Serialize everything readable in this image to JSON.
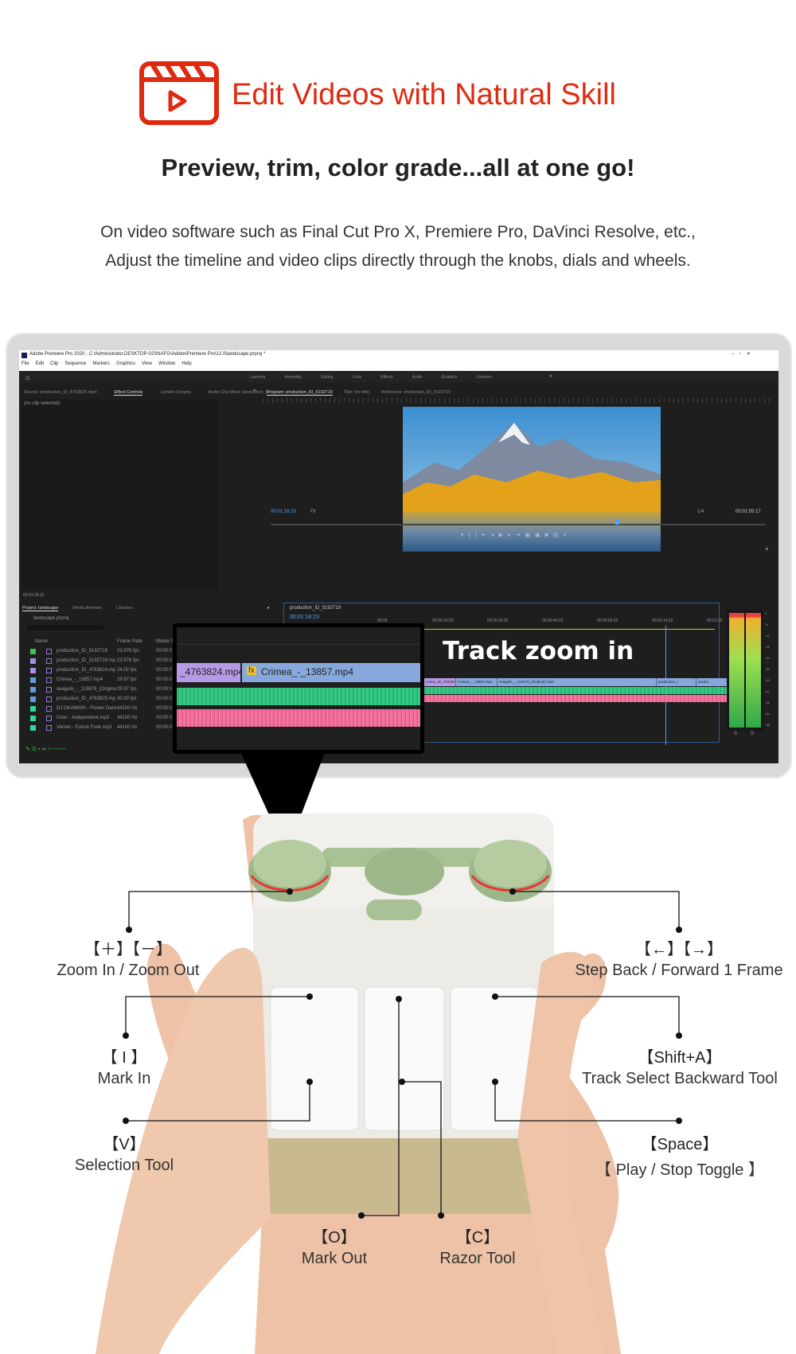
{
  "header": {
    "logo_icon": "video-clapper-play-icon",
    "title": "Edit Videos with Natural Skill",
    "subtitle": "Preview, trim, color grade...all at one go!",
    "body_lines": [
      "On video software such as Final Cut Pro X, Premiere Pro, DaVinci Resolve, etc.,",
      "Adjust the timeline and video clips directly through the knobs, dials and wheels."
    ],
    "accent_color": "#e02a10"
  },
  "app": {
    "window_title": "Adobe Premiere Pro 2020 - C:\\Administrator.DESKTOP-02SNAFG\\Adobe\\Premiere Pro\\12.0\\landscape.prproj *",
    "menu": [
      "File",
      "Edit",
      "Clip",
      "Sequence",
      "Markers",
      "Graphics",
      "View",
      "Window",
      "Help"
    ],
    "workspaces": [
      "Learning",
      "Assembly",
      "Editing",
      "Color",
      "Effects",
      "Audio",
      "Graphics",
      "Libraries"
    ],
    "source_tabs": [
      "Source: production_ID_4763825.mp4",
      "Effect Controls",
      "Lumetri Scopes",
      "Audio Clip Mixer: production_ID"
    ],
    "no_clip": "(no clip selected)",
    "source_timecode": "00:01:18:23",
    "program_tabs": [
      "Program: production_ID_5192719",
      "Title: (no title)",
      "Reference: production_ID_5192719"
    ],
    "program_timecode": "00:01:18:23",
    "fit": "Fit",
    "resolution": "1/4",
    "duration": "00:01:55:17",
    "project_tabs": [
      "Project: landscape",
      "Media Browser",
      "Libraries"
    ],
    "project_file": "landscape.prproj",
    "columns": [
      "Name",
      "Frame Rate",
      "Media S"
    ],
    "items": [
      {
        "name": "production_ID_5192719",
        "rate": "23.976 fps",
        "start": "00:00:0",
        "color": "#3fbf5a"
      },
      {
        "name": "production_ID_5192719.mp",
        "rate": "23.976 fps",
        "start": "00:00:0",
        "color": "#a98be8"
      },
      {
        "name": "production_ID_4763824.mp",
        "rate": "24.00 fps",
        "start": "00:00:0",
        "color": "#a98be8"
      },
      {
        "name": "Crimea_-_13857.mp4",
        "rate": "29.97 fps",
        "start": "00:00:0",
        "color": "#5e9de0"
      },
      {
        "name": "seagulls_-_113679_(Origina",
        "rate": "29.97 fps",
        "start": "00:00:0",
        "color": "#5e9de0"
      },
      {
        "name": "production_ID_4763825.mp",
        "rate": "30.00 fps",
        "start": "00:00:0",
        "color": "#5e9de0"
      },
      {
        "name": "DJ OKAWARI - Flower Danc",
        "rate": "44100 Hz",
        "start": "00:00:0",
        "color": "#2fd79a"
      },
      {
        "name": "Uzier - Independent.mp3",
        "rate": "44100 Hz",
        "start": "00:00:0",
        "color": "#2fd79a"
      },
      {
        "name": "Vanien - Future Funk.mp3",
        "rate": "44100 Hz",
        "start": "00:00:0",
        "color": "#2fd79a"
      }
    ],
    "sequence_tab": "production_ID_5192719",
    "sequence_timecode": "00:01:18:23",
    "ruler": [
      "00:00",
      "00:00:14:23",
      "00:00:29:23",
      "00:00:44:22",
      "00:00:59:22",
      "00:01:14:22",
      "00:01:29"
    ],
    "clips": [
      "uction_ID_4763824",
      "Crimea_-_13857.mp4",
      "seagulls_-_113679_(Original).mp4",
      "production_I",
      "produc"
    ],
    "meter_scale": [
      "0",
      "-6",
      "-12",
      "-18",
      "-24",
      "-30",
      "-36",
      "-42",
      "-48",
      "-54",
      "-dB"
    ],
    "meter_solo": [
      "S",
      "S"
    ]
  },
  "callout": {
    "clip_a": "_4763824.mp4",
    "clip_b": "Crimea_-_13857.mp4",
    "fx": "fx",
    "caption": "Track zoom in"
  },
  "keys": [
    {
      "key": "【＋】【－】",
      "action": "Zoom In / Zoom Out"
    },
    {
      "key": "【←】【→】",
      "action": "Step Back / Forward 1 Frame"
    },
    {
      "key": "【 I 】",
      "action": "Mark In"
    },
    {
      "key": "【Shift+A】",
      "action": "Track Select Backward Tool"
    },
    {
      "key": "【V】",
      "action": "Selection Tool"
    },
    {
      "key": "【Space】",
      "action": "【 Play / Stop Toggle 】"
    },
    {
      "key": "【O】",
      "action": "Mark Out"
    },
    {
      "key": "【C】",
      "action": "Razor Tool"
    }
  ],
  "device_colors": {
    "knob": "#a9c295",
    "body": "#f1f0ec",
    "base": "#c9b98f"
  }
}
